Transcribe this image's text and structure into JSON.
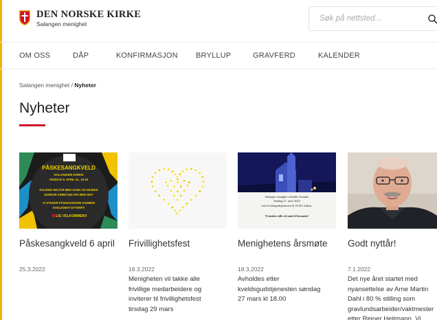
{
  "header": {
    "org_name": "DEN NORSKE KIRKE",
    "parish_name": "Salangen menighet",
    "search_placeholder": "Søk på nettsted..."
  },
  "nav": {
    "items": [
      "OM OSS",
      "DÅP",
      "KONFIRMASJON",
      "BRYLLUP",
      "GRAVFERD",
      "KALENDER"
    ]
  },
  "breadcrumb": {
    "parent": "Salangen menighet",
    "separator": " / ",
    "current": "Nyheter"
  },
  "page": {
    "title": "Nyheter"
  },
  "poster": {
    "title": "PÅSKESANGKVELD",
    "church": "SALANGEN KIRKE",
    "date": "ONSDAG 6. APRIL KL. 19.30",
    "line1": "SALDING DELTAR MED SANG OG MUSIKK",
    "line2": "GUNNAR SÆBØ DELTAR MED DIKT",
    "line3": "VI SYNGER PÅSKESANGER SAMMEN",
    "line4": "KVELDSMAT ETTERPÅ",
    "welcome": "LIG VELKOMMEN!!"
  },
  "notice": {
    "line1": "Salangen menighet avholder årsmøte",
    "line2": "Søndag 27. mars 2022",
    "line3": "etter kveldsgudstjenesten kl 18.00 i kirken.",
    "line4": "Vi ønsker alle vel møtt til årsmøte!"
  },
  "cards": [
    {
      "title": "Påskesangkveld 6 april",
      "date": "25.3.2022",
      "text": ""
    },
    {
      "title": "Frivillighetsfest",
      "date": "18.3.2022",
      "text": "Menigheten vil takke alle frivillige medarbeidere og inviterer til frivillighetsfest tirsdag 29 mars"
    },
    {
      "title": "Menighetens årsmøte",
      "date": "18.3.2022",
      "text": "Avholdes etter kveldsgudstjenesten søndag 27 mars kl 18.00"
    },
    {
      "title": "Godt nyttår!",
      "date": "7.1.2022",
      "text": "Det nye året startet med nyansettelse av  Arne Martin Dahl i 80 % stilling som gravlundsarbeider/vaktmester etter Reiner Heitmann. Vi"
    }
  ],
  "colors": {
    "accent_red": "#d0102a",
    "stripe_yellow": "#f0b400"
  }
}
